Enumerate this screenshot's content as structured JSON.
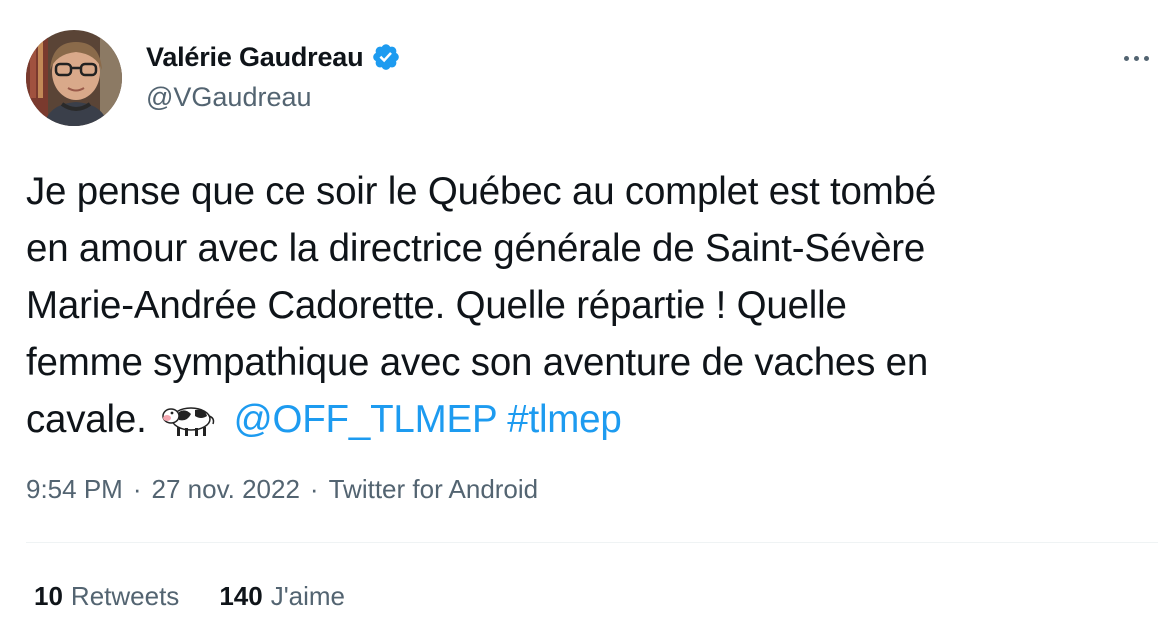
{
  "author": {
    "display_name": "Valérie Gaudreau",
    "handle": "@VGaudreau",
    "verified": true,
    "avatar_icon": "user-photo"
  },
  "more_icon": "more-horizontal-icon",
  "tweet": {
    "line1": "Je pense que ce soir le Québec au complet est tombé",
    "line2": "en amour avec la directrice générale de Saint-Sévère",
    "line3": "Marie-Andrée Cadorette. Quelle répartie ! Quelle",
    "line4": "femme sympathique avec son aventure de vaches en",
    "line5_text": "cavale.",
    "emoji": "cow-icon",
    "mention": "@OFF_TLMEP",
    "hashtag": "#tlmep"
  },
  "meta": {
    "time": "9:54 PM",
    "separator": "·",
    "date": "27 nov. 2022",
    "source": "Twitter for Android"
  },
  "stats": {
    "retweets_count": "10",
    "retweets_label": "Retweets",
    "likes_count": "140",
    "likes_label": "J'aime"
  },
  "colors": {
    "link": "#1d9bf0",
    "secondary_text": "#536471",
    "primary_text": "#0f1419",
    "divider": "#eff3f4"
  }
}
